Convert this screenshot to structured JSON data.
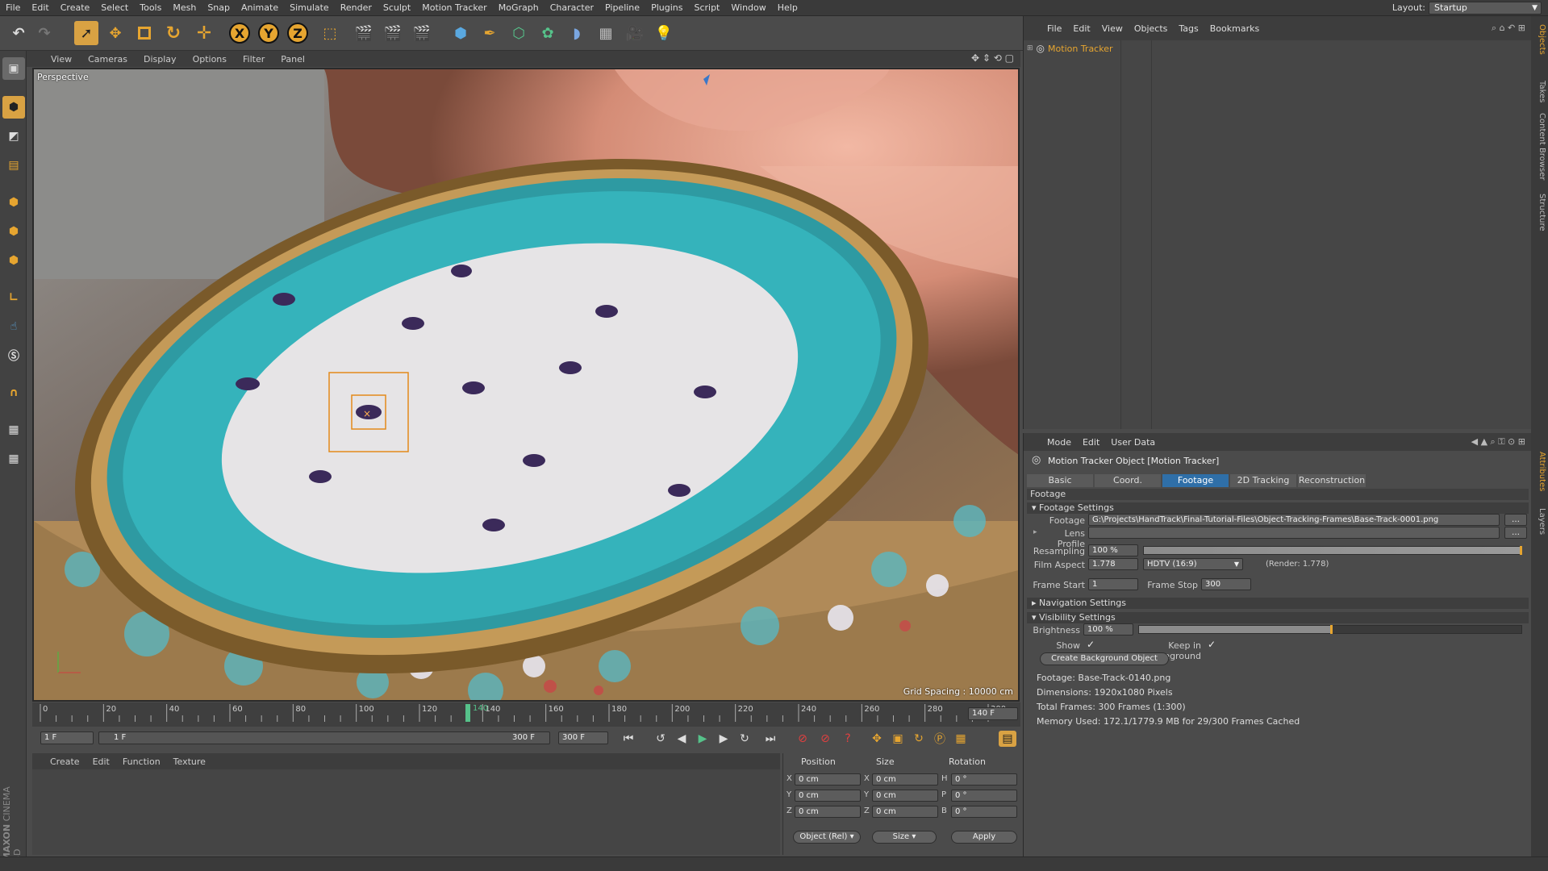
{
  "menubar": {
    "items": [
      "File",
      "Edit",
      "Create",
      "Select",
      "Tools",
      "Mesh",
      "Snap",
      "Animate",
      "Simulate",
      "Render",
      "Sculpt",
      "Motion Tracker",
      "MoGraph",
      "Character",
      "Pipeline",
      "Plugins",
      "Script",
      "Window",
      "Help"
    ],
    "layout_label": "Layout:",
    "layout_value": "Startup"
  },
  "toolbar": {
    "x_label": "X",
    "y_label": "Y",
    "z_label": "Z"
  },
  "viewport": {
    "menu": [
      "View",
      "Cameras",
      "Display",
      "Options",
      "Filter",
      "Panel"
    ],
    "camera_label": "Perspective",
    "grid_spacing": "Grid Spacing : 10000 cm"
  },
  "timeline": {
    "ticks": [
      "0",
      "20",
      "40",
      "60",
      "80",
      "100",
      "120",
      "140",
      "160",
      "180",
      "200",
      "220",
      "240",
      "260",
      "280",
      "300"
    ],
    "current_frame": "140",
    "end_field": "140 F",
    "start_field": "1 F",
    "range_start": "1 F",
    "range_end": "300 F",
    "max_field": "300 F"
  },
  "materials": {
    "menu": [
      "Create",
      "Edit",
      "Function",
      "Texture"
    ]
  },
  "coords": {
    "headers": [
      "Position",
      "Size",
      "Rotation"
    ],
    "rows": [
      {
        "axis": "X",
        "pos": "0 cm",
        "size_axis": "X",
        "size": "0 cm",
        "rot_axis": "H",
        "rot": "0 °"
      },
      {
        "axis": "Y",
        "pos": "0 cm",
        "size_axis": "Y",
        "size": "0 cm",
        "rot_axis": "P",
        "rot": "0 °"
      },
      {
        "axis": "Z",
        "pos": "0 cm",
        "size_axis": "Z",
        "size": "0 cm",
        "rot_axis": "B",
        "rot": "0 °"
      }
    ],
    "mode_select": "Object (Rel)",
    "size_select": "Size",
    "apply_label": "Apply"
  },
  "objects": {
    "menu": [
      "File",
      "Edit",
      "View",
      "Objects",
      "Tags",
      "Bookmarks"
    ],
    "item_name": "Motion Tracker"
  },
  "attributes": {
    "menu": [
      "Mode",
      "Edit",
      "User Data"
    ],
    "title": "Motion Tracker Object [Motion Tracker]",
    "tabs": [
      "Basic",
      "Coord.",
      "Footage",
      "2D Tracking",
      "Reconstruction"
    ],
    "active_tab": "Footage",
    "section_title": "Footage",
    "footage_settings": "Footage Settings",
    "footage_label": "Footage",
    "footage_path": "G:\\Projects\\HandTrack\\Final-Tutorial-Files\\Object-Tracking-Frames\\Base-Track-0001.png",
    "lens_profile_label": "Lens Profile",
    "resampling_label": "Resampling",
    "resampling_value": "100 %",
    "film_aspect_label": "Film Aspect",
    "film_aspect_value": "1.778",
    "film_aspect_preset": "HDTV (16:9)",
    "render_aspect": "(Render: 1.778)",
    "frame_start_label": "Frame Start",
    "frame_start_value": "1",
    "frame_stop_label": "Frame Stop",
    "frame_stop_value": "300",
    "navigation_settings": "Navigation Settings",
    "visibility_settings": "Visibility Settings",
    "brightness_label": "Brightness",
    "brightness_value": "100 %",
    "brightness_level": 0.5,
    "show_image_label": "Show Image",
    "keep_foreground_label": "Keep in Foreground",
    "create_bg_button": "Create Background Object",
    "info": [
      "Footage: Base-Track-0140.png",
      "Dimensions: 1920x1080 Pixels",
      "Total Frames: 300 Frames (1:300)",
      "Memory Used: 172.1/1779.9 MB for 29/300 Frames Cached"
    ]
  },
  "side_tabs": [
    "Objects",
    "Takes",
    "Content Browser",
    "Structure",
    "Attributes",
    "Layers"
  ],
  "brand": {
    "maxon": "MAXON",
    "product": "CINEMA 4D"
  }
}
